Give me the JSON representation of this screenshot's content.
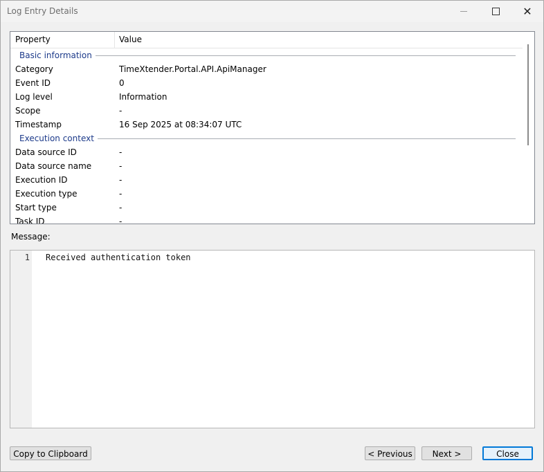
{
  "window": {
    "title": "Log Entry Details",
    "minimize_icon": "minimize-icon",
    "maximize_icon": "maximize-icon",
    "close_glyph": "✕"
  },
  "grid": {
    "columns": {
      "property": "Property",
      "value": "Value"
    },
    "groups": [
      {
        "label": "Basic information",
        "rows": [
          {
            "key": "Category",
            "value": "TimeXtender.Portal.API.ApiManager"
          },
          {
            "key": "Event ID",
            "value": "0"
          },
          {
            "key": "Log level",
            "value": "Information"
          },
          {
            "key": "Scope",
            "value": "-"
          },
          {
            "key": "Timestamp",
            "value": "16 Sep 2025 at 08:34:07 UTC"
          }
        ]
      },
      {
        "label": "Execution context",
        "rows": [
          {
            "key": "Data source ID",
            "value": "-"
          },
          {
            "key": "Data source name",
            "value": "-"
          },
          {
            "key": "Execution ID",
            "value": "-"
          },
          {
            "key": "Execution type",
            "value": "-"
          },
          {
            "key": "Start type",
            "value": "-"
          },
          {
            "key": "Task ID",
            "value": "-"
          }
        ]
      }
    ]
  },
  "message": {
    "label": "Message:",
    "line_number": "1",
    "text": "Received authentication token"
  },
  "buttons": {
    "copy": "Copy to Clipboard",
    "previous": "< Previous",
    "next": "Next >",
    "close": "Close"
  }
}
